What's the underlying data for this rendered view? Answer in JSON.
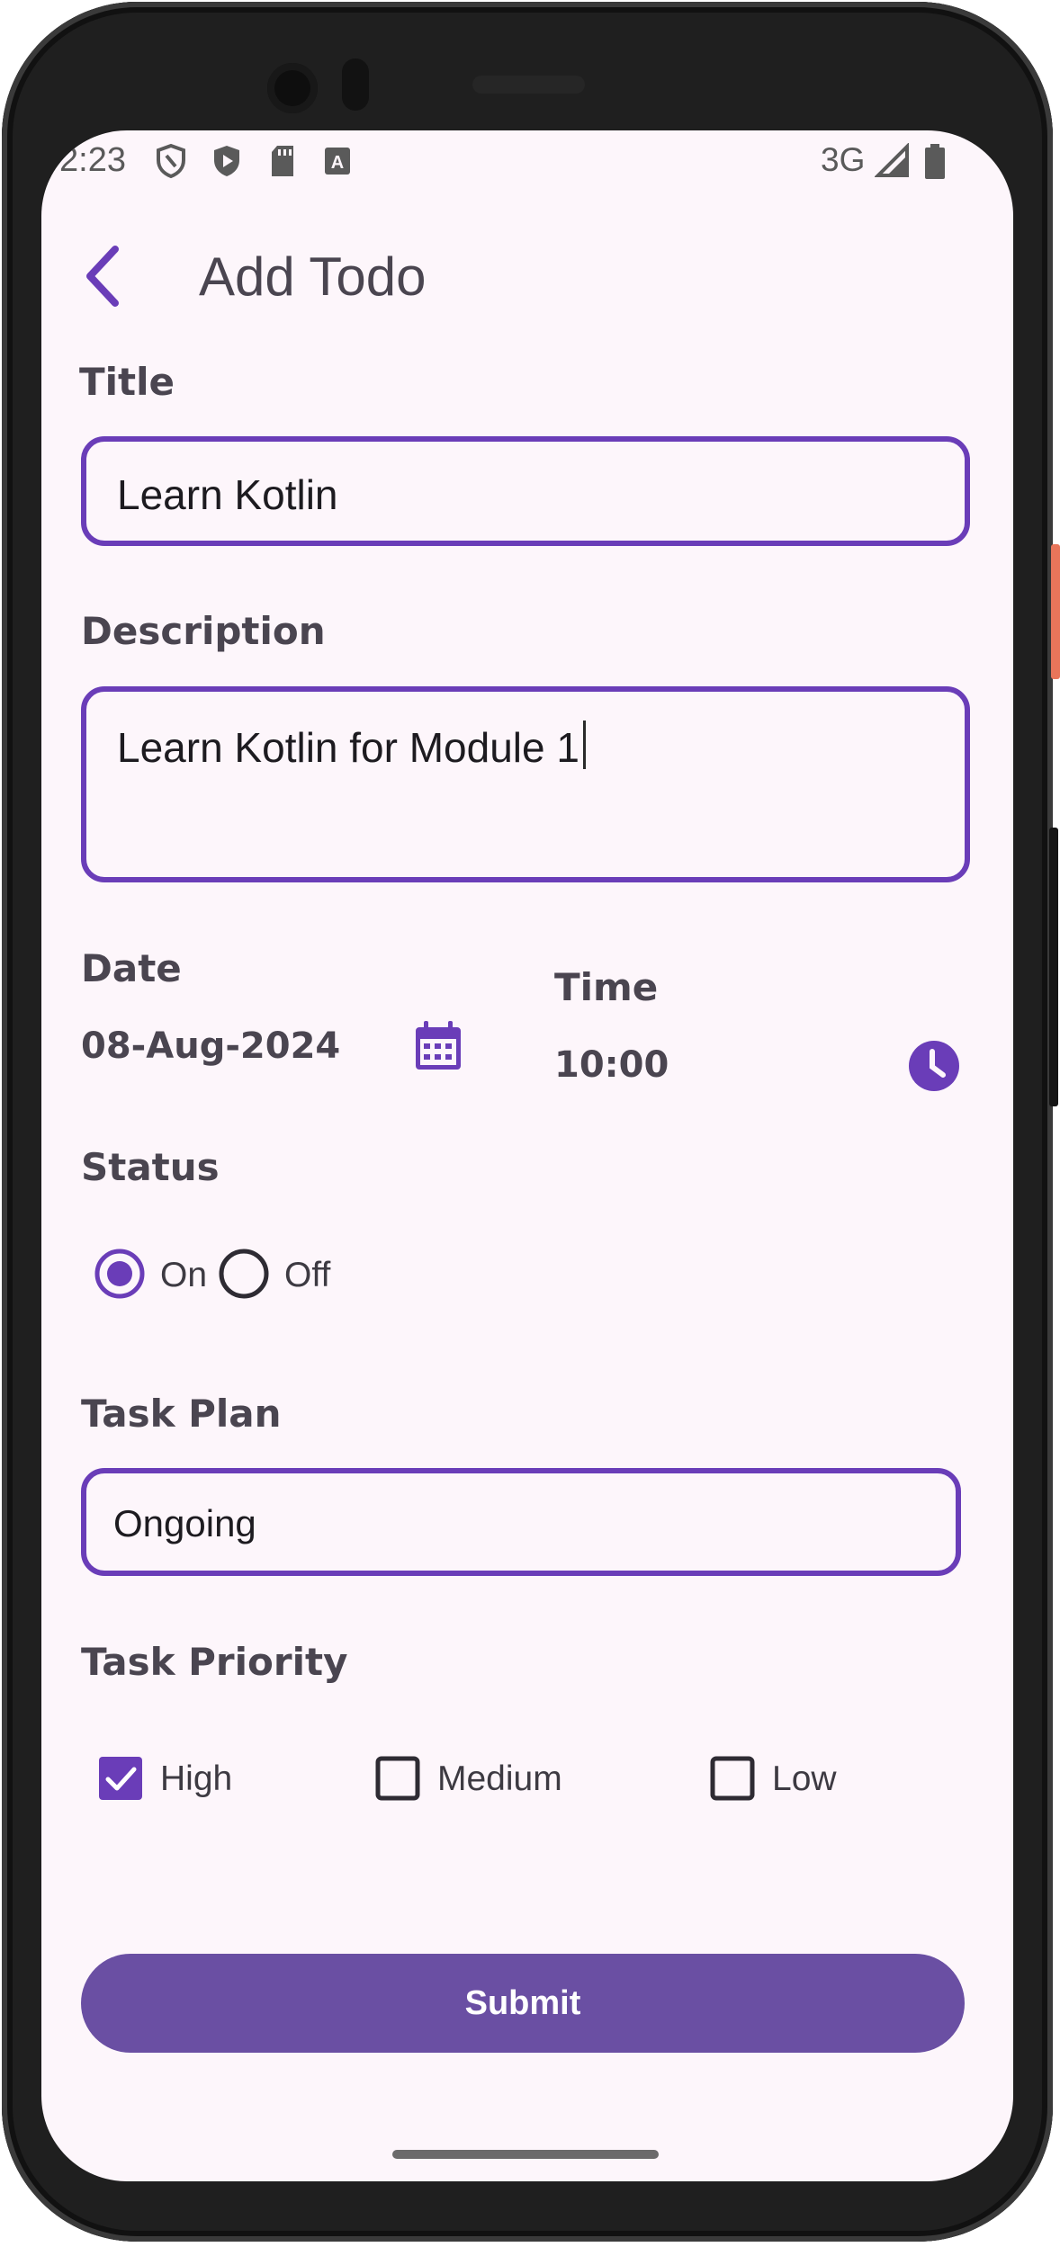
{
  "status_bar": {
    "time": "2:23",
    "network": "3G",
    "icons": [
      "shield-outline-icon",
      "shield-play-icon",
      "sd-card-icon",
      "font-a-icon",
      "signal-icon",
      "battery-icon"
    ]
  },
  "app_bar": {
    "title": "Add Todo",
    "back_icon": "chevron-left-icon"
  },
  "form": {
    "title_label": "Title",
    "title_value": "Learn Kotlin",
    "description_label": "Description",
    "description_value": "Learn Kotlin for Module 1",
    "date_label": "Date",
    "date_value": "08-Aug-2024",
    "time_label": "Time",
    "time_value": "10:00",
    "status_label": "Status",
    "status_options": [
      {
        "label": "On",
        "selected": true
      },
      {
        "label": "Off",
        "selected": false
      }
    ],
    "task_plan_label": "Task Plan",
    "task_plan_value": "Ongoing",
    "task_priority_label": "Task Priority",
    "priority_options": [
      {
        "label": "High",
        "checked": true
      },
      {
        "label": "Medium",
        "checked": false
      },
      {
        "label": "Low",
        "checked": false
      }
    ],
    "submit_label": "Submit"
  },
  "colors": {
    "accent": "#6a3db8",
    "button": "#6a4fa3",
    "background": "#fdf6fb",
    "label_text": "#4a4550"
  }
}
